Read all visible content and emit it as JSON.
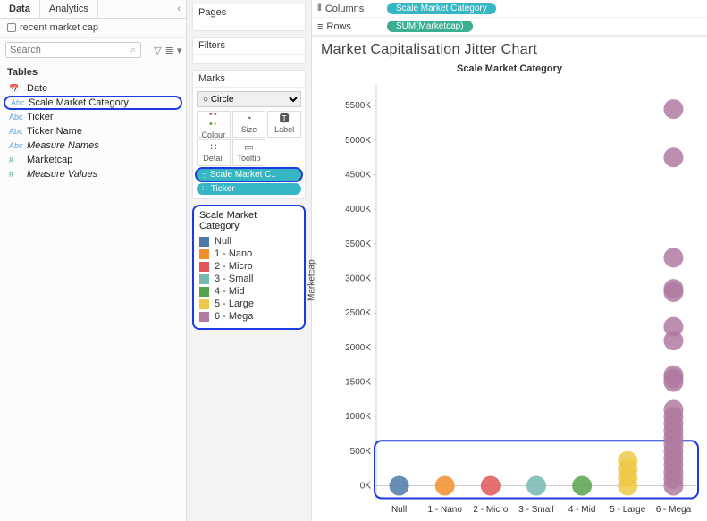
{
  "data_pane": {
    "tabs": {
      "data": "Data",
      "analytics": "Analytics"
    },
    "source": "recent market cap",
    "search_placeholder": "Search",
    "tables_header": "Tables",
    "fields": [
      {
        "type": "date",
        "name": "Date"
      },
      {
        "type": "abc",
        "name": "Scale Market Category",
        "highlight": true
      },
      {
        "type": "abc",
        "name": "Ticker"
      },
      {
        "type": "abc",
        "name": "Ticker Name"
      },
      {
        "type": "abc-it",
        "name": "Measure Names",
        "italic": true
      },
      {
        "type": "num",
        "name": "Marketcap"
      },
      {
        "type": "num",
        "name": "Measure Values",
        "italic": true
      }
    ]
  },
  "cards": {
    "pages": "Pages",
    "filters": "Filters",
    "marks": {
      "title": "Marks",
      "shape": "Circle",
      "cells": {
        "colour": "Colour",
        "size": "Size",
        "label": "Label",
        "detail": "Detail",
        "tooltip": "Tooltip"
      },
      "pills": [
        {
          "label": "Scale Market C..",
          "icon": "colour",
          "highlight": true
        },
        {
          "label": "Ticker",
          "icon": "detail"
        }
      ]
    },
    "legend": {
      "title": "Scale Market Category",
      "items": [
        {
          "label": "Null",
          "color": "#4e79a7"
        },
        {
          "label": "1 - Nano",
          "color": "#f28e2b"
        },
        {
          "label": "2 - Micro",
          "color": "#e15759"
        },
        {
          "label": "3 - Small",
          "color": "#76b7b2"
        },
        {
          "label": "4 - Mid",
          "color": "#59a14f"
        },
        {
          "label": "5 - Large",
          "color": "#edc948"
        },
        {
          "label": "6 - Mega",
          "color": "#b07aa1"
        }
      ]
    }
  },
  "shelves": {
    "columns_label": "Columns",
    "rows_label": "Rows",
    "columns_pill": "Scale Market Category",
    "rows_pill": "SUM(Marketcap)"
  },
  "viz": {
    "title": "Market Capitalisation Jitter Chart",
    "col_header": "Scale Market Category",
    "ylabel": "Marketcap"
  },
  "chart_data": {
    "type": "scatter",
    "xlabel": "Scale Market Category",
    "ylabel": "Marketcap",
    "categories": [
      "Null",
      "1 - Nano",
      "2 - Micro",
      "3 - Small",
      "4 - Mid",
      "5 - Large",
      "6 - Mega"
    ],
    "colors": [
      "#4e79a7",
      "#f28e2b",
      "#e15759",
      "#76b7b2",
      "#59a14f",
      "#edc948",
      "#b07aa1"
    ],
    "y_ticks": [
      0,
      500,
      1000,
      1500,
      2000,
      2500,
      3000,
      3500,
      4000,
      4500,
      5000,
      5500
    ],
    "y_tick_labels": [
      "0K",
      "500K",
      "1000K",
      "1500K",
      "2000K",
      "2500K",
      "3000K",
      "3500K",
      "4000K",
      "4500K",
      "5000K",
      "5500K"
    ],
    "ylim": [
      -200,
      5800
    ],
    "cluster_radius": 11,
    "series": [
      {
        "name": "Null",
        "x": "Null",
        "ys": [
          0
        ]
      },
      {
        "name": "1 - Nano",
        "x": "1 - Nano",
        "ys": [
          0
        ]
      },
      {
        "name": "2 - Micro",
        "x": "2 - Micro",
        "ys": [
          0
        ]
      },
      {
        "name": "3 - Small",
        "x": "3 - Small",
        "ys": [
          0
        ]
      },
      {
        "name": "4 - Mid",
        "x": "4 - Mid",
        "ys": [
          0
        ]
      },
      {
        "name": "5 - Large",
        "x": "5 - Large",
        "ys": [
          0,
          120,
          240,
          360
        ]
      },
      {
        "name": "6 - Mega",
        "x": "6 - Mega",
        "ys": [
          0,
          100,
          200,
          300,
          400,
          500,
          600,
          700,
          800,
          900,
          1000,
          1100,
          1500,
          1550,
          1600,
          2100,
          2300,
          2800,
          2850,
          3300,
          4750,
          5450
        ]
      }
    ]
  }
}
